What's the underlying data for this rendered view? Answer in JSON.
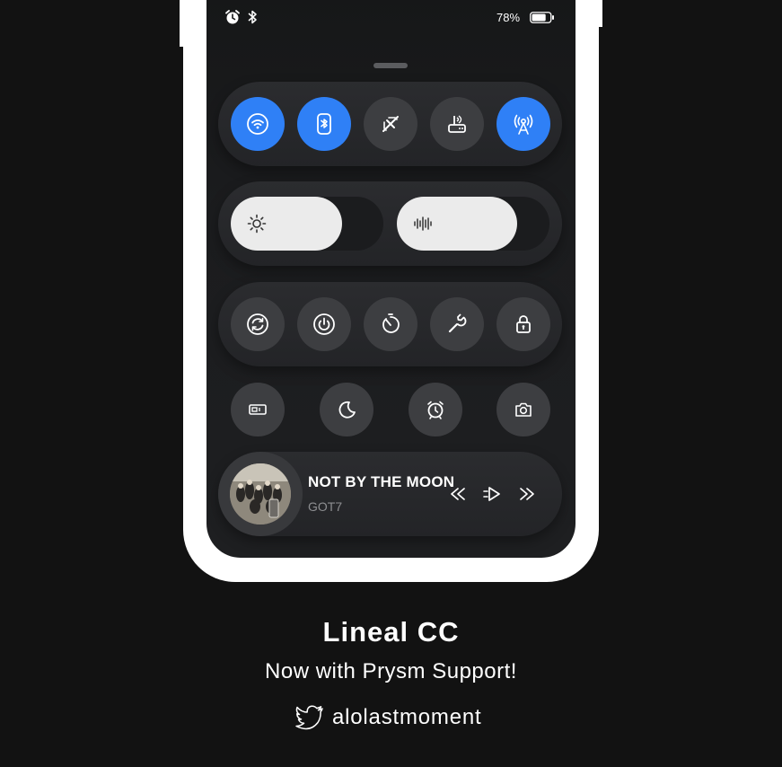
{
  "status_bar": {
    "battery_percent": "78%",
    "battery_level": 0.78
  },
  "connectivity_toggles": [
    {
      "name": "wifi-icon",
      "active": true
    },
    {
      "name": "bluetooth-icon",
      "active": true
    },
    {
      "name": "airplane-mode-icon",
      "active": false
    },
    {
      "name": "router-icon",
      "active": false
    },
    {
      "name": "cellular-antenna-icon",
      "active": true
    }
  ],
  "sliders": [
    {
      "name": "brightness",
      "icon": "sun-icon",
      "level": 0.73
    },
    {
      "name": "volume",
      "icon": "sound-wave-icon",
      "level": 0.79
    }
  ],
  "utility_toggles": [
    {
      "name": "rotation-icon"
    },
    {
      "name": "power-icon"
    },
    {
      "name": "timer-icon"
    },
    {
      "name": "wrench-icon"
    },
    {
      "name": "lock-icon"
    }
  ],
  "extra_toggles": [
    {
      "name": "screen-record-icon"
    },
    {
      "name": "moon-icon"
    },
    {
      "name": "alarm-clock-icon"
    },
    {
      "name": "camera-icon"
    }
  ],
  "now_playing": {
    "title": "NOT BY THE MOON",
    "artist": "GOT7"
  },
  "promo": {
    "title": "Lineal CC",
    "subtitle": "Now with Prysm Support!",
    "twitter_handle": "alolastmoment"
  },
  "colors": {
    "accent": "#2f80f6",
    "background": "#121212",
    "toggle_off": "#3d3e41"
  }
}
